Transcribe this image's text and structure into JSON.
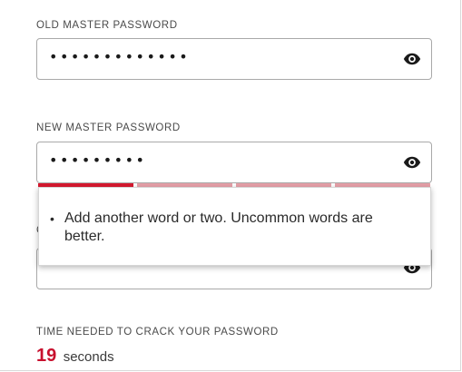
{
  "old_password": {
    "label": "OLD MASTER PASSWORD",
    "masked_value": "•••••••••••••",
    "toggle_icon": "eye-icon"
  },
  "new_password": {
    "label": "NEW MASTER PASSWORD",
    "masked_value": "•••••••••",
    "toggle_icon": "eye-icon",
    "strength_filled_segments": 1,
    "strength_total_segments": 4,
    "strength_fill_color": "#d7192f",
    "strength_empty_color": "#e7a0a8"
  },
  "confirm_password": {
    "toggle_icon": "eye-icon"
  },
  "feedback": {
    "tips": [
      "Add another word or two. Uncommon words are better."
    ]
  },
  "crack_time": {
    "label": "TIME NEEDED TO CRACK YOUR PASSWORD",
    "value": "19",
    "unit": "seconds",
    "value_color": "#c8102e"
  }
}
